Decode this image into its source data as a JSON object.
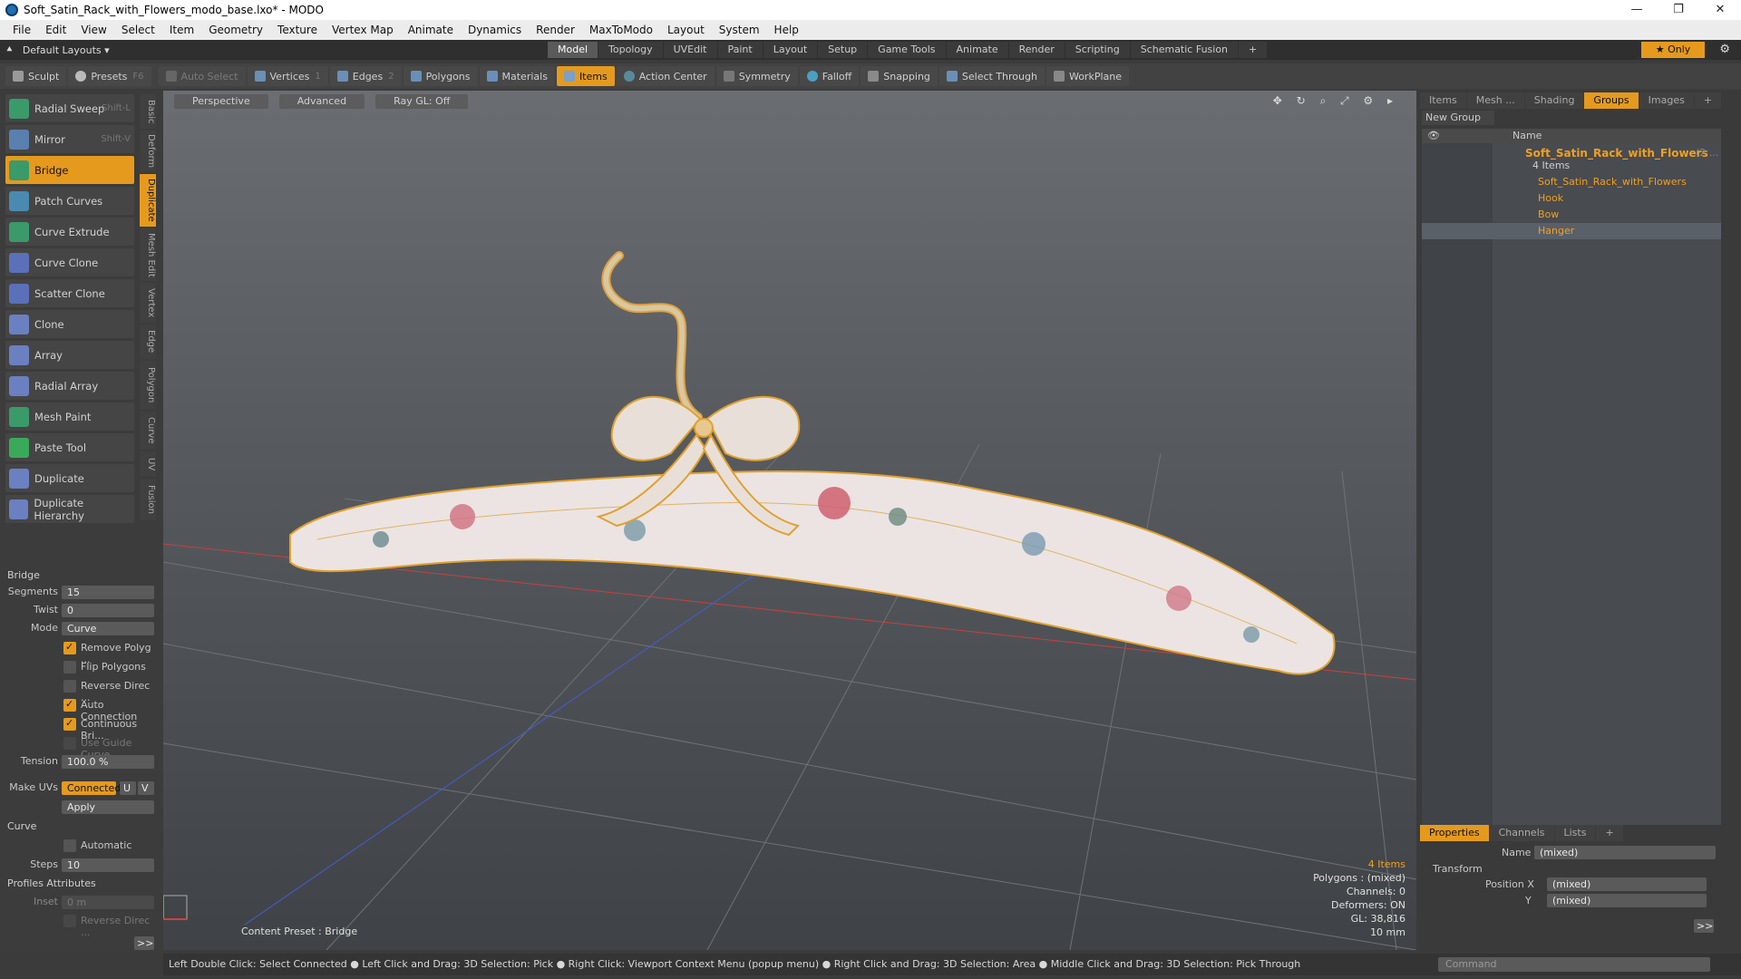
{
  "window": {
    "title": "Soft_Satin_Rack_with_Flowers_modo_base.lxo* - MODO",
    "min": "—",
    "max": "❐",
    "close": "✕"
  },
  "menu": [
    "File",
    "Edit",
    "View",
    "Select",
    "Item",
    "Geometry",
    "Texture",
    "Vertex Map",
    "Animate",
    "Dynamics",
    "Render",
    "MaxToModo",
    "Layout",
    "System",
    "Help"
  ],
  "layout": {
    "selector": "Default Layouts ▾",
    "tabs": [
      "Model",
      "Topology",
      "UVEdit",
      "Paint",
      "Layout",
      "Setup",
      "Game Tools",
      "Animate",
      "Render",
      "Scripting",
      "Schematic Fusion",
      "+"
    ],
    "only": "★ Only"
  },
  "toolbar": {
    "sculpt": "Sculpt",
    "presets": "Presets",
    "presets_key": "F6",
    "auto_select": "Auto Select",
    "vertices": "Vertices",
    "vertices_n": "1",
    "edges": "Edges",
    "edges_n": "2",
    "polygons": "Polygons",
    "materials": "Materials",
    "items": "Items",
    "action_center": "Action Center",
    "symmetry": "Symmetry",
    "falloff": "Falloff",
    "snapping": "Snapping",
    "select_through": "Select Through",
    "workplane": "WorkPlane"
  },
  "tools": [
    {
      "label": "Radial Sweep",
      "key": "Shift-L"
    },
    {
      "label": "Mirror",
      "key": "Shift-V"
    },
    {
      "label": "Bridge",
      "key": ""
    },
    {
      "label": "Patch Curves",
      "key": ""
    },
    {
      "label": "Curve Extrude",
      "key": ""
    },
    {
      "label": "Curve Clone",
      "key": ""
    },
    {
      "label": "Scatter Clone",
      "key": ""
    },
    {
      "label": "Clone",
      "key": ""
    },
    {
      "label": "Array",
      "key": ""
    },
    {
      "label": "Radial Array",
      "key": ""
    },
    {
      "label": "Mesh Paint",
      "key": ""
    },
    {
      "label": "Paste Tool",
      "key": ""
    },
    {
      "label": "Duplicate",
      "key": ""
    },
    {
      "label": "Duplicate Hierarchy",
      "key": ""
    }
  ],
  "vtabs": [
    "Basic",
    "Deform",
    "Duplicate",
    "Mesh Edit",
    "Vertex",
    "Edge",
    "Polygon",
    "Curve",
    "UV",
    "Fusion"
  ],
  "bridge": {
    "header": "Bridge",
    "segments_label": "Segments",
    "segments": "15",
    "twist_label": "Twist",
    "twist": "0",
    "mode_label": "Mode",
    "mode": "Curve",
    "remove_poly": "Remove Polyg ...",
    "flip": "Flip Polygons",
    "reverse": "Reverse Direc ...",
    "auto_conn": "Auto Connection",
    "continuous": "Continuous Bri...",
    "use_guide": "Use Guide Curve",
    "tension_label": "Tension",
    "tension": "100.0 %",
    "make_uvs_label": "Make UVs",
    "connected": "Connected",
    "u": "U",
    "v": "V",
    "apply": "Apply"
  },
  "curve": {
    "header": "Curve",
    "automatic": "Automatic",
    "steps_label": "Steps",
    "steps": "10"
  },
  "profiles": {
    "header": "Profiles Attributes",
    "inset_label": "Inset",
    "inset": "0 m",
    "reverse": "Reverse Direc ...",
    "more": ">>"
  },
  "viewport": {
    "perspective": "Perspective",
    "advanced": "Advanced",
    "raygl": "Ray GL: Off",
    "icons": "✥ ↻ ⌕ ⤢ ⚙ ▸",
    "preset": "Content Preset : Bridge",
    "stats": {
      "items": "4 Items",
      "polygons": "Polygons : (mixed)",
      "channels": "Channels: 0",
      "deformers": "Deformers: ON",
      "gl": "GL: 38,816",
      "scale": "10 mm"
    }
  },
  "right": {
    "tabs": [
      "Items",
      "Mesh ...",
      "Shading",
      "Groups",
      "Images",
      "+"
    ],
    "new_group": "New Group",
    "name_col": "Name",
    "group": "Soft_Satin_Rack_with_Flowers",
    "group_suffix": "(2 ...",
    "count": "4 Items",
    "children": [
      "Soft_Satin_Rack_with_Flowers",
      "Hook",
      "Bow",
      "Hanger"
    ]
  },
  "props": {
    "tabs": [
      "Properties",
      "Channels",
      "Lists",
      "+"
    ],
    "name_label": "Name",
    "name": "(mixed)",
    "transform": "Transform",
    "posx_label": "Position X",
    "posx": "(mixed)",
    "y_label": "Y",
    "y": "(mixed)",
    "more": ">>"
  },
  "status": "Left Double Click: Select Connected ● Left Click and Drag: 3D Selection: Pick ● Right Click: Viewport Context Menu (popup menu) ● Right Click and Drag: 3D Selection: Area ● Middle Click and Drag: 3D Selection: Pick Through",
  "command": {
    "placeholder": "Command"
  }
}
